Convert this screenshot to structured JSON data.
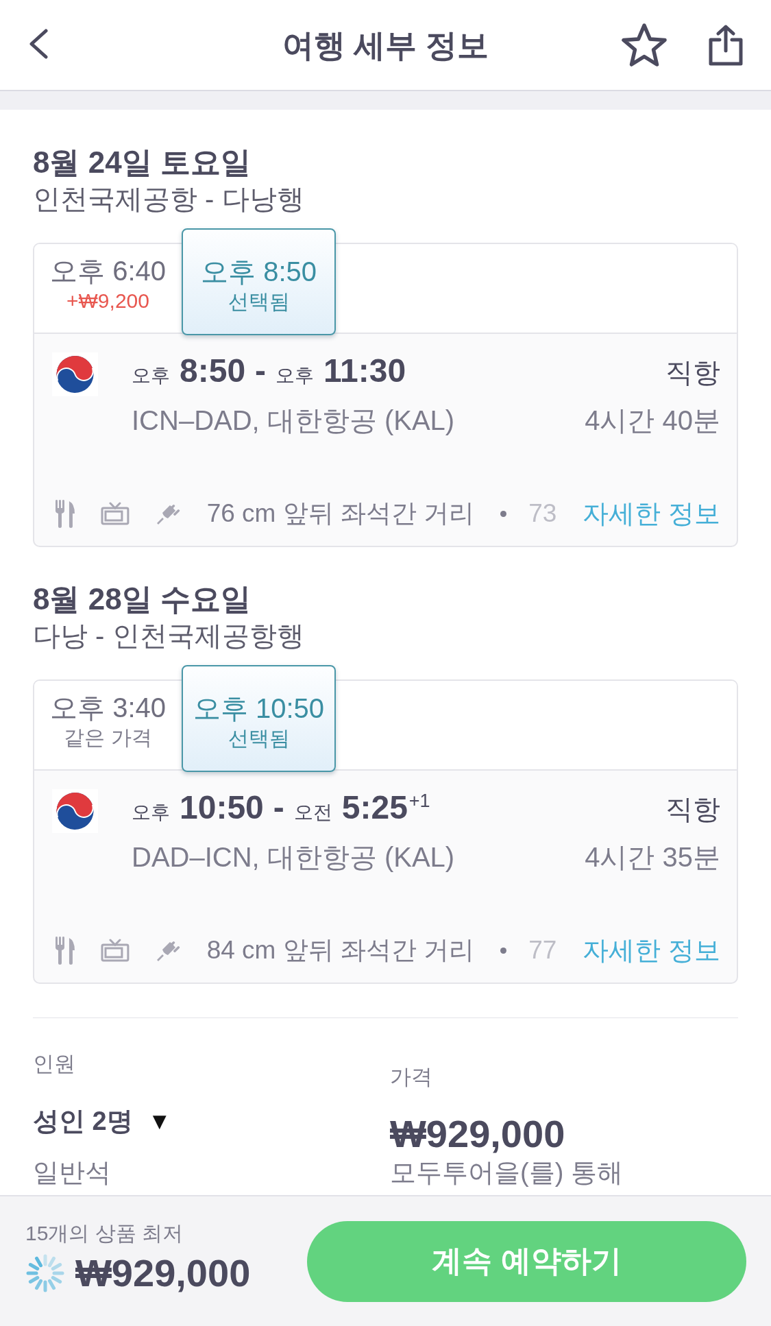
{
  "header": {
    "title": "여행 세부 정보"
  },
  "legs": [
    {
      "date": "8월 24일 토요일",
      "route": "인천국제공항 - 다낭행",
      "options": [
        {
          "time": "오후 6:40",
          "note": "+₩9,200",
          "kind": "surcharge",
          "selected": false
        },
        {
          "time": "오후 8:50",
          "note": "선택됨",
          "kind": "current",
          "selected": true
        }
      ],
      "flight": {
        "depart_period": "오후",
        "depart_time": "8:50",
        "separator": "-",
        "arrive_period": "오후",
        "arrive_time": "11:30",
        "stops": "직항",
        "route": "ICN–DAD, 대한항공 (KAL)",
        "duration": "4시간 40분"
      },
      "amenities": {
        "seat_pitch": "76 cm 앞뒤 좌석간 거리",
        "more": "73",
        "link": "자세한 정보"
      }
    },
    {
      "date": "8월 28일 수요일",
      "route": "다낭 - 인천국제공항행",
      "options": [
        {
          "time": "오후 3:40",
          "note": "같은 가격",
          "kind": "same_price",
          "selected": false
        },
        {
          "time": "오후 10:50",
          "note": "선택됨",
          "kind": "current",
          "selected": true
        }
      ],
      "flight": {
        "depart_period": "오후",
        "depart_time": "10:50",
        "separator": "-",
        "arrive_period": "오전",
        "arrive_time": "5:25",
        "day_offset": "+1",
        "stops": "직항",
        "route": "DAD–ICN, 대한항공 (KAL)",
        "duration": "4시간 35분"
      },
      "amenities": {
        "seat_pitch": "84 cm 앞뒤 좌석간 거리",
        "more": "77",
        "link": "자세한 정보"
      }
    }
  ],
  "booking": {
    "passengers_label": "인원",
    "passengers": "성인 2명",
    "caret": "▼",
    "cabin": "일반석",
    "price_label": "가격",
    "price": "₩929,000",
    "seller": "모두투어을(를) 통해"
  },
  "footer": {
    "deals": "15개의 상품 최저",
    "price": "₩929,000",
    "button": "계속 예약하기"
  }
}
